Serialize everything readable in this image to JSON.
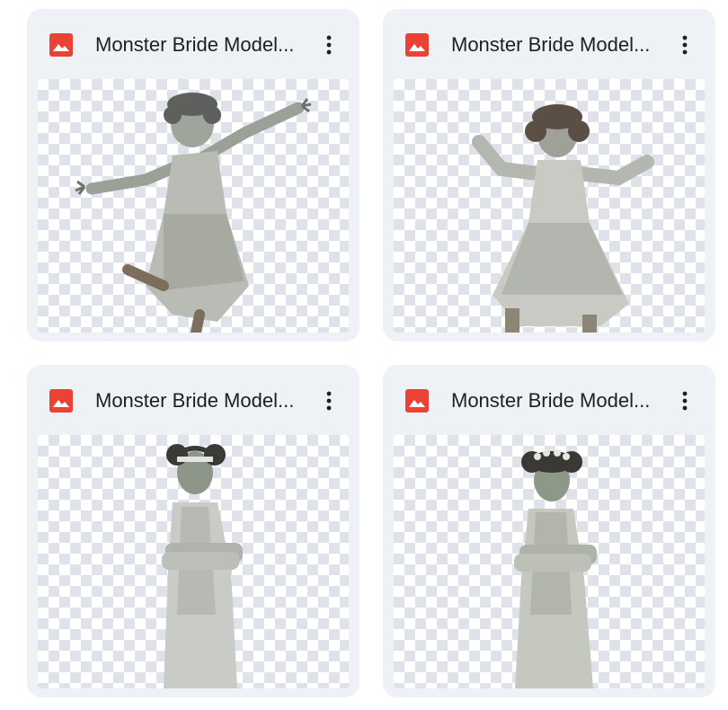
{
  "files": [
    {
      "title": "Monster Bride Model...",
      "icon": "image-file-icon",
      "menu_icon": "more-vert-icon",
      "pose": "leaping"
    },
    {
      "title": "Monster Bride Model...",
      "icon": "image-file-icon",
      "menu_icon": "more-vert-icon",
      "pose": "dancing"
    },
    {
      "title": "Monster Bride Model...",
      "icon": "image-file-icon",
      "menu_icon": "more-vert-icon",
      "pose": "arms-crossed"
    },
    {
      "title": "Monster Bride Model...",
      "icon": "image-file-icon",
      "menu_icon": "more-vert-icon",
      "pose": "arms-crossed-flowers"
    }
  ],
  "colors": {
    "card_bg": "#eef1f6",
    "icon_red": "#ea4335",
    "text": "#1f1f1f"
  }
}
